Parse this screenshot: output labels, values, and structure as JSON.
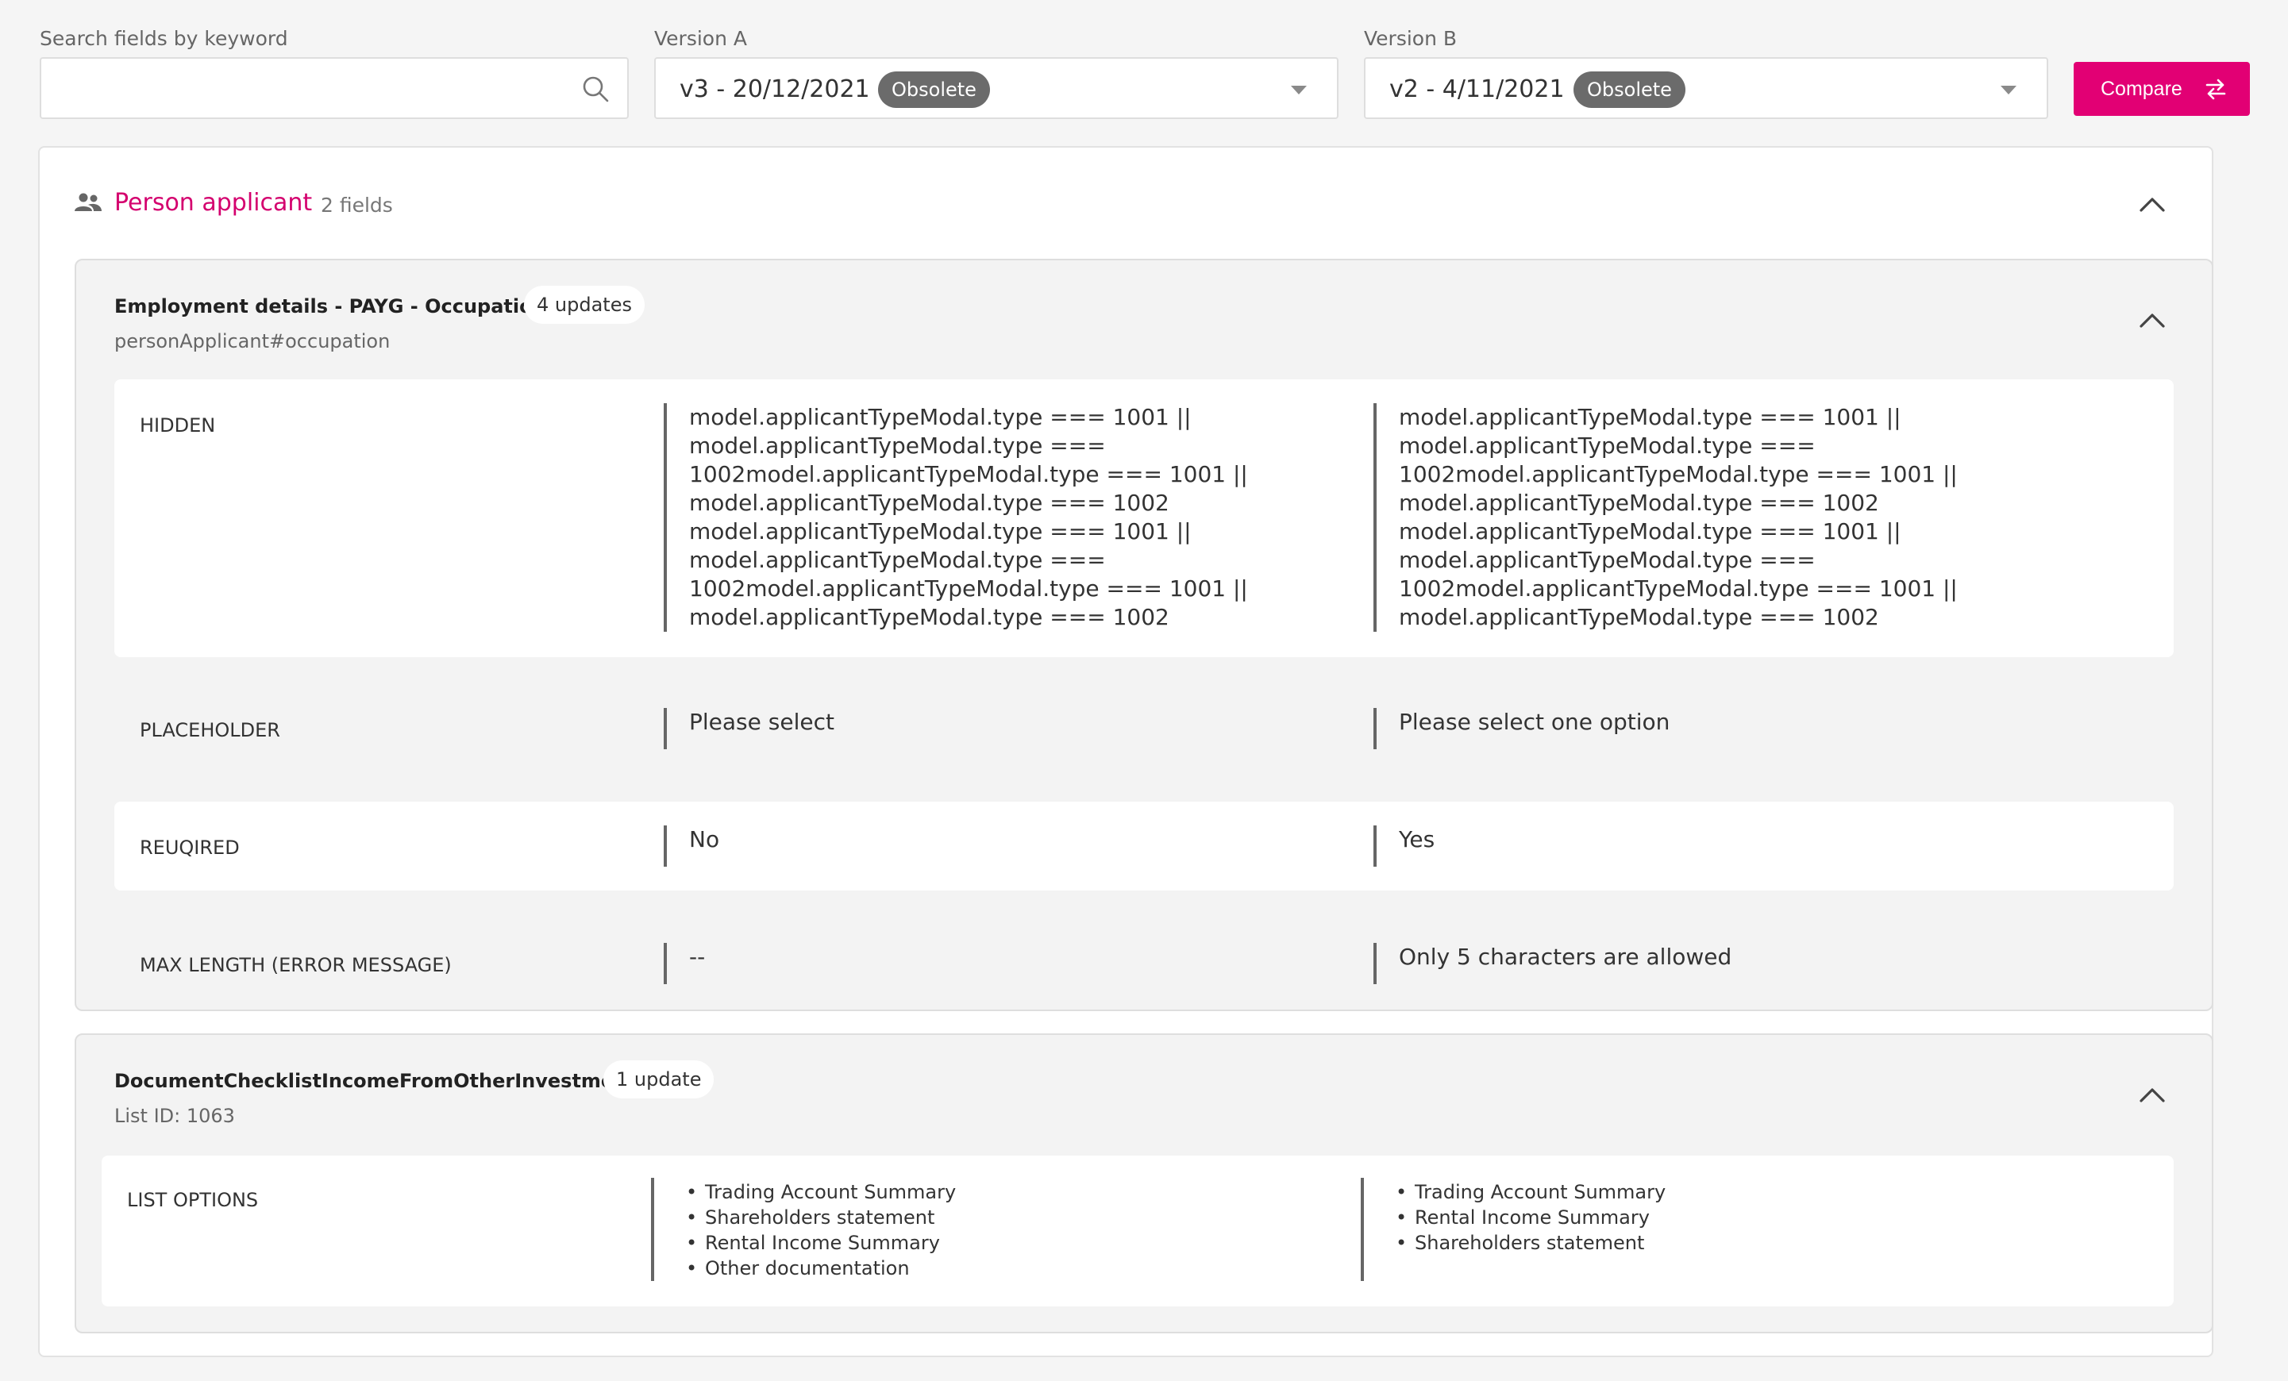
{
  "filters": {
    "search_label": "Search fields by keyword",
    "search_placeholder": "",
    "version_a_label": "Version A",
    "version_a_value": "v3 - 20/12/2021",
    "version_a_badge": "Obsolete",
    "version_b_label": "Version B",
    "version_b_value": "v2 - 4/11/2021",
    "version_b_badge": "Obsolete",
    "compare_label": "Compare"
  },
  "section": {
    "title": "Person applicant",
    "count": "2 fields",
    "icon": "people-icon"
  },
  "fields": [
    {
      "title": "Employment details - PAYG - Occupation",
      "updates": "4 updates",
      "subtitle": "personApplicant#occupation",
      "rows": [
        {
          "property": "HIDDEN",
          "a": [
            "model.applicantTypeModal.type === 1001 ||",
            "model.applicantTypeModal.type ===",
            "1002model.applicantTypeModal.type === 1001 ||",
            "model.applicantTypeModal.type === 1002",
            "model.applicantTypeModal.type === 1001 ||",
            "model.applicantTypeModal.type ===",
            "1002model.applicantTypeModal.type === 1001 ||",
            "model.applicantTypeModal.type === 1002"
          ],
          "b": [
            "model.applicantTypeModal.type === 1001 ||",
            "model.applicantTypeModal.type ===",
            "1002model.applicantTypeModal.type === 1001 ||",
            "model.applicantTypeModal.type === 1002",
            "model.applicantTypeModal.type === 1001 ||",
            "model.applicantTypeModal.type ===",
            "1002model.applicantTypeModal.type === 1001 ||",
            "model.applicantTypeModal.type === 1002"
          ]
        },
        {
          "property": "PLACEHOLDER",
          "a": "Please select",
          "b": "Please select one option"
        },
        {
          "property": "REUQIRED",
          "a": "No",
          "b": "Yes"
        },
        {
          "property": "MAX LENGTH (ERROR MESSAGE)",
          "a": "--",
          "b": "Only 5 characters are allowed"
        }
      ]
    },
    {
      "title": "DocumentChecklistIncomeFromOtherInvestments",
      "updates": "1 update",
      "subtitle": "List ID: 1063",
      "rows": [
        {
          "property": "LIST OPTIONS",
          "a": [
            "Trading Account Summary",
            "Shareholders statement",
            "Rental Income Summary",
            "Other documentation"
          ],
          "b": [
            "Trading Account Summary",
            "Rental Income Summary",
            "Shareholders statement"
          ]
        }
      ]
    }
  ],
  "colors": {
    "accent": "#e20074",
    "section_title": "#d4006e",
    "badge": "#6b6b6b"
  }
}
